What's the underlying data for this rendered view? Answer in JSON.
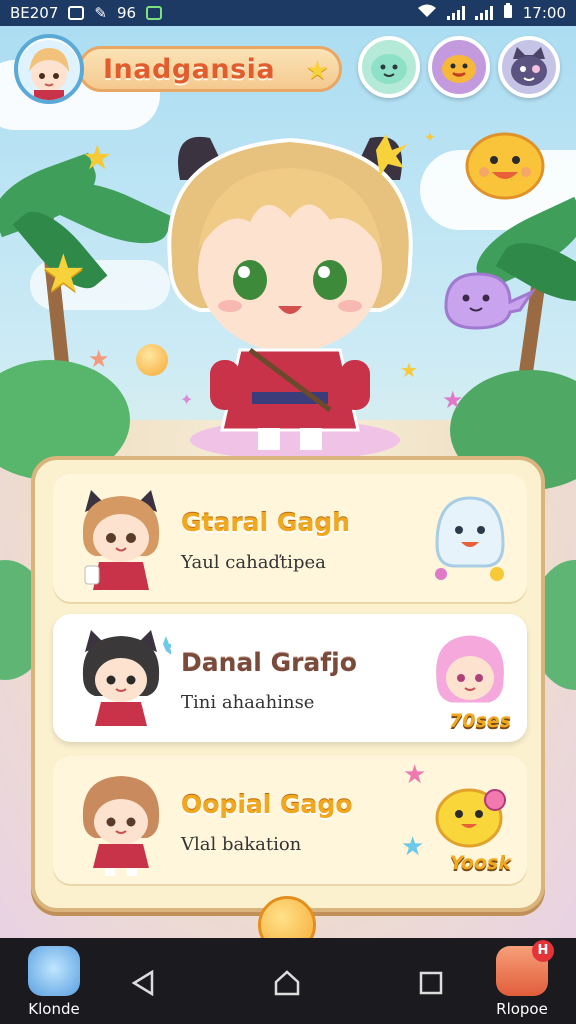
{
  "status_bar": {
    "left_text": "BE207",
    "icons": [
      "location-icon",
      "wrench-icon",
      "nfc-icon",
      "image-icon"
    ],
    "mid_text": "96",
    "time": "17:00"
  },
  "top_bar": {
    "title": "Inadgansia"
  },
  "characters": [
    {
      "name": "Gtaral Gagh",
      "subtitle": "Yaul cahaďtipea",
      "pet_label": "",
      "active": false
    },
    {
      "name": "Danal Grafjo",
      "subtitle": "Tini ahaahinse",
      "pet_label": "70ses",
      "active": true
    },
    {
      "name": "Oopial Gago",
      "subtitle": "Vlal bakation",
      "pet_label": "Yoosk",
      "active": false
    }
  ],
  "nav_bar": {
    "left_app_label": "Klonde",
    "right_app_label": "Rlopoe",
    "right_app_badge": "H"
  },
  "colors": {
    "status_bar": "#1c3a63",
    "title_text": "#e25d2d",
    "panel_bg": "#fbf1cf",
    "panel_border": "#d9b47c",
    "name_gold": "#f0a820"
  }
}
